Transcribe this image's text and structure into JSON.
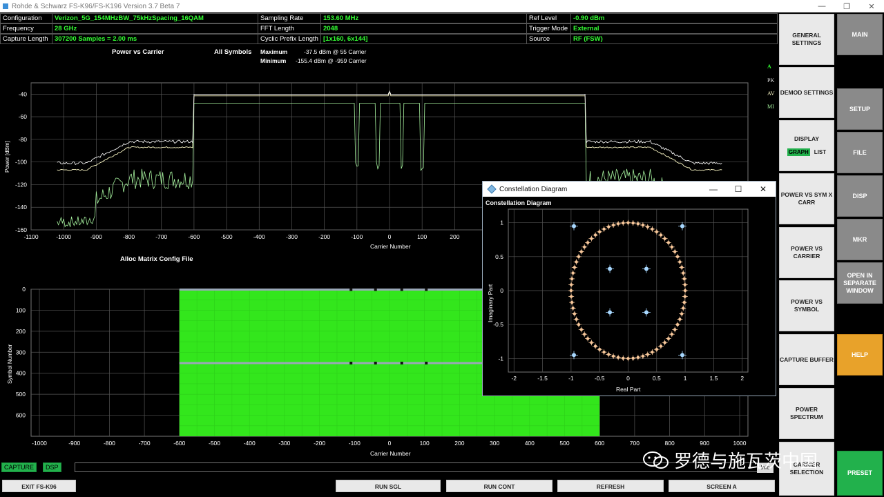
{
  "window": {
    "title": "Rohde & Schwarz FS-K96/FS-K196 Version 3.7 Beta 7",
    "minimize": "—",
    "restore": "❐",
    "close": "✕"
  },
  "info": {
    "configuration_label": "Configuration",
    "configuration_value": "Verizon_5G_154MHzBW_75kHzSpacing_16QAM",
    "frequency_label": "Frequency",
    "frequency_value": "28 GHz",
    "capture_length_label": "Capture Length",
    "capture_length_value": "307200 Samples = 2.00 ms",
    "sampling_rate_label": "Sampling Rate",
    "sampling_rate_value": "153.60 MHz",
    "fft_length_label": "FFT Length",
    "fft_length_value": "2048",
    "cp_length_label": "Cyclic Prefix Length",
    "cp_length_value": "[1x160, 6x144]",
    "ref_level_label": "Ref Level",
    "ref_level_value": "-0.90 dBm",
    "trigger_mode_label": "Trigger Mode",
    "trigger_mode_value": "External",
    "source_label": "Source",
    "source_value": "RF (FSW)"
  },
  "power_chart": {
    "title": "Power vs Carrier",
    "all_symbols": "All Symbols",
    "maximum_label": "Maximum",
    "maximum_value": "-37.5 dBm @ 55 Carrier",
    "minimum_label": "Minimum",
    "minimum_value": "-155.4 dBm @ -959 Carrier",
    "xlabel": "Carrier Number",
    "ylabel": "Power [dBm]",
    "xticks": [
      "-1100",
      "-1000",
      "-900",
      "-800",
      "-700",
      "-600",
      "-500",
      "-400",
      "-300",
      "-200",
      "-100",
      "0",
      "100",
      "200"
    ],
    "yticks": [
      "-40",
      "-60",
      "-80",
      "-100",
      "-120",
      "-140",
      "-160"
    ],
    "trace_a": "A",
    "trace_pk": "PK",
    "trace_av": "AV",
    "trace_mi": "MI",
    "trace_av2": "AV"
  },
  "alloc_chart": {
    "title": "Alloc Matrix Config File",
    "xlabel": "Carrier Number",
    "ylabel": "Symbol Number",
    "xticks": [
      "-1000",
      "-900",
      "-800",
      "-700",
      "-600",
      "-500",
      "-400",
      "-300",
      "-200",
      "-100",
      "0",
      "100",
      "200",
      "300",
      "400",
      "500",
      "600",
      "700",
      "800",
      "900",
      "1000"
    ],
    "yticks": [
      "0",
      "100",
      "200",
      "300",
      "400",
      "500",
      "600"
    ],
    "fill_color": "#33e61c"
  },
  "constellation": {
    "window_title": "Constellation Diagram",
    "subtitle": "Constellation Diagram",
    "xlabel": "Real Part",
    "ylabel": "Imaginary Part",
    "xticks": [
      "-2",
      "-1.5",
      "-1",
      "-0.5",
      "0",
      "0.5",
      "1",
      "1.5",
      "2"
    ],
    "yticks": [
      "1",
      "0.5",
      "0",
      "-0.5",
      "-1"
    ],
    "minimize": "—",
    "maximize": "☐",
    "close": "✕"
  },
  "right_panel": {
    "general_settings": "GENERAL SETTINGS",
    "demod_settings": "DEMOD SETTINGS",
    "display": "DISPLAY",
    "graph": "GRAPH",
    "list": "LIST",
    "power_vs_sym_x_carr": "POWER VS SYM X CARR",
    "power_vs_carrier": "POWER VS CARRIER",
    "power_vs_symbol": "POWER VS SYMBOL",
    "capture_buffer": "CAPTURE BUFFER",
    "power_spectrum": "POWER SPECTRUM",
    "carrier_selection_line1": "CARRIER",
    "carrier_selection_line2": "SELECTION",
    "main": "MAIN",
    "setup": "SETUP",
    "file": "FILE",
    "disp": "DISP",
    "mkr": "MKR",
    "open_in_separate_window": "OPEN IN SEPARATE WINDOW",
    "help": "HELP",
    "preset": "PRESET"
  },
  "bottom": {
    "capture": "CAPTURE",
    "dsp": "DSP",
    "info": "Info",
    "exit": "EXIT FS-K96",
    "run_sgl": "RUN SGL",
    "run_cont": "RUN CONT",
    "refresh": "REFRESH",
    "screen_a": "SCREEN A"
  },
  "watermark": "罗德与施瓦茨中国",
  "colors": {
    "trace_max": "#f2f2f2",
    "trace_avg": "#fffbc8",
    "trace_min": "#a8f5a0",
    "alloc_fill": "#33e61c",
    "accent_green": "#22b14c",
    "help_orange": "#e8a22a",
    "constellation_ring": "#f7c79a",
    "constellation_dot": "#a8d8ff"
  }
}
